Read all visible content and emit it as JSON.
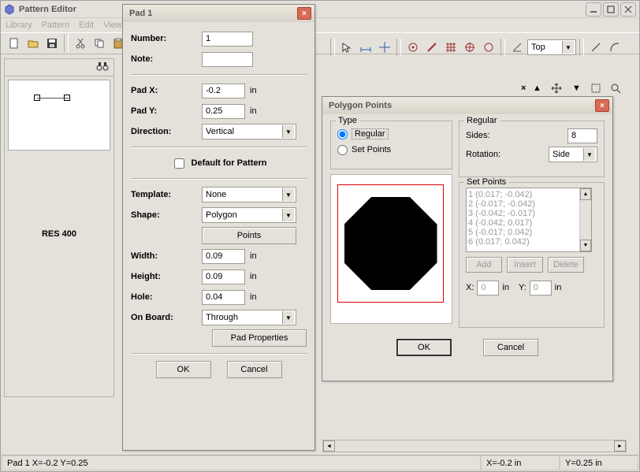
{
  "window": {
    "title": "Pattern Editor"
  },
  "menu": {
    "library": "Library",
    "pattern": "Pattern",
    "edit": "Edit",
    "view": "View"
  },
  "toolbar_right": {
    "layer_label": "Top"
  },
  "library_panel": {
    "item_name": "RES 400"
  },
  "status": {
    "left": "Pad 1  X=-0.2  Y=0.25",
    "x": "X=-0.2 in",
    "y": "Y=0.25 in"
  },
  "pad_dialog": {
    "title": "Pad 1",
    "number_label": "Number:",
    "number_value": "1",
    "note_label": "Note:",
    "note_value": "",
    "padx_label": "Pad X:",
    "padx_value": "-0.2",
    "pady_label": "Pad Y:",
    "pady_value": "0.25",
    "unit": "in",
    "direction_label": "Direction:",
    "direction_value": "Vertical",
    "default_label": "Default for Pattern",
    "template_label": "Template:",
    "template_value": "None",
    "shape_label": "Shape:",
    "shape_value": "Polygon",
    "points_btn": "Points",
    "width_label": "Width:",
    "width_value": "0.09",
    "height_label": "Height:",
    "height_value": "0.09",
    "hole_label": "Hole:",
    "hole_value": "0.04",
    "onboard_label": "On Board:",
    "onboard_value": "Through",
    "padprops_btn": "Pad Properties",
    "ok": "OK",
    "cancel": "Cancel"
  },
  "poly_dialog": {
    "title": "Polygon Points",
    "type_title": "Type",
    "type_regular": "Regular",
    "type_setpoints": "Set Points",
    "regular_title": "Regular",
    "sides_label": "Sides:",
    "sides_value": "8",
    "rotation_label": "Rotation:",
    "rotation_value": "Side",
    "setpoints_title": "Set Points",
    "points": [
      "1 (0.017; -0.042)",
      "2 (-0.017; -0.042)",
      "3 (-0.042; -0.017)",
      "4 (-0.042; 0.017)",
      "5 (-0.017; 0.042)",
      "6 (0.017; 0.042)"
    ],
    "add": "Add",
    "insert": "Insert",
    "delete": "Delete",
    "x_label": "X:",
    "x_value": "0",
    "y_label": "Y:",
    "y_value": "0",
    "unit": "in",
    "ok": "OK",
    "cancel": "Cancel"
  }
}
